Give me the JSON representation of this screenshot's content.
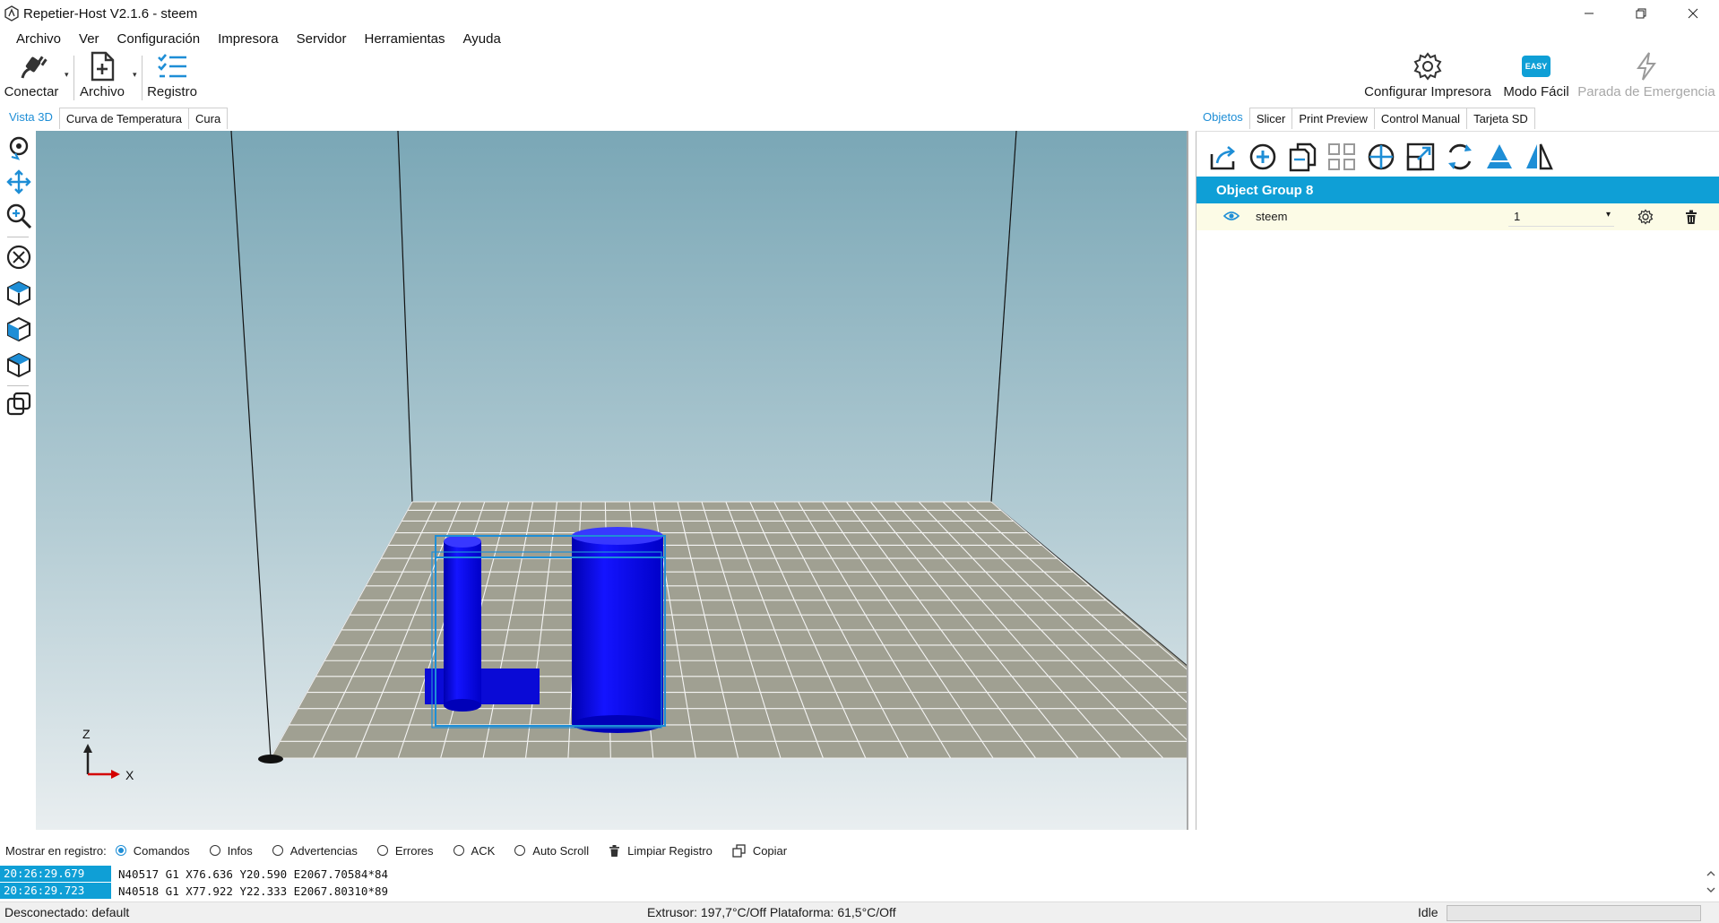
{
  "window": {
    "title": "Repetier-Host V2.1.6 - steem",
    "icon": "repetier-logo-icon"
  },
  "menu": [
    "Archivo",
    "Ver",
    "Configuración",
    "Impresora",
    "Servidor",
    "Herramientas",
    "Ayuda"
  ],
  "toolbar": {
    "connect_label": "Conectar",
    "file_label": "Archivo",
    "log_label": "Registro",
    "printer_config_label": "Configurar Impresora",
    "easy_mode_label": "Modo Fácil",
    "easy_badge": "EASY",
    "emergency_label": "Parada de Emergencia"
  },
  "left_tabs": [
    "Vista 3D",
    "Curva de Temperatura",
    "Cura"
  ],
  "right_tabs": [
    "Objetos",
    "Slicer",
    "Print Preview",
    "Control Manual",
    "Tarjeta SD"
  ],
  "viewport": {
    "axis_z": "Z",
    "axis_x": "X",
    "object_color": "#0000ee",
    "bed_color": "#a0a092"
  },
  "objects": {
    "group_name": "Object Group 8",
    "items": [
      {
        "name": "steem",
        "copies": "1"
      }
    ]
  },
  "log_options": {
    "label": "Mostrar en registro:",
    "commands": "Comandos",
    "infos": "Infos",
    "warnings": "Advertencias",
    "errors": "Errores",
    "ack": "ACK",
    "autoscroll": "Auto Scroll",
    "clear": "Limpiar Registro",
    "copy": "Copiar"
  },
  "log_lines": [
    {
      "time": "20:26:29.679",
      "text": "N40517 G1 X76.636 Y20.590 E2067.70584*84"
    },
    {
      "time": "20:26:29.723",
      "text": "N40518 G1 X77.922 Y22.333 E2067.80310*89"
    }
  ],
  "status": {
    "connection": "Desconectado: default",
    "temperatures": "Extrusor: 197,7°C/Off Plataforma: 61,5°C/Off",
    "state": "Idle"
  }
}
